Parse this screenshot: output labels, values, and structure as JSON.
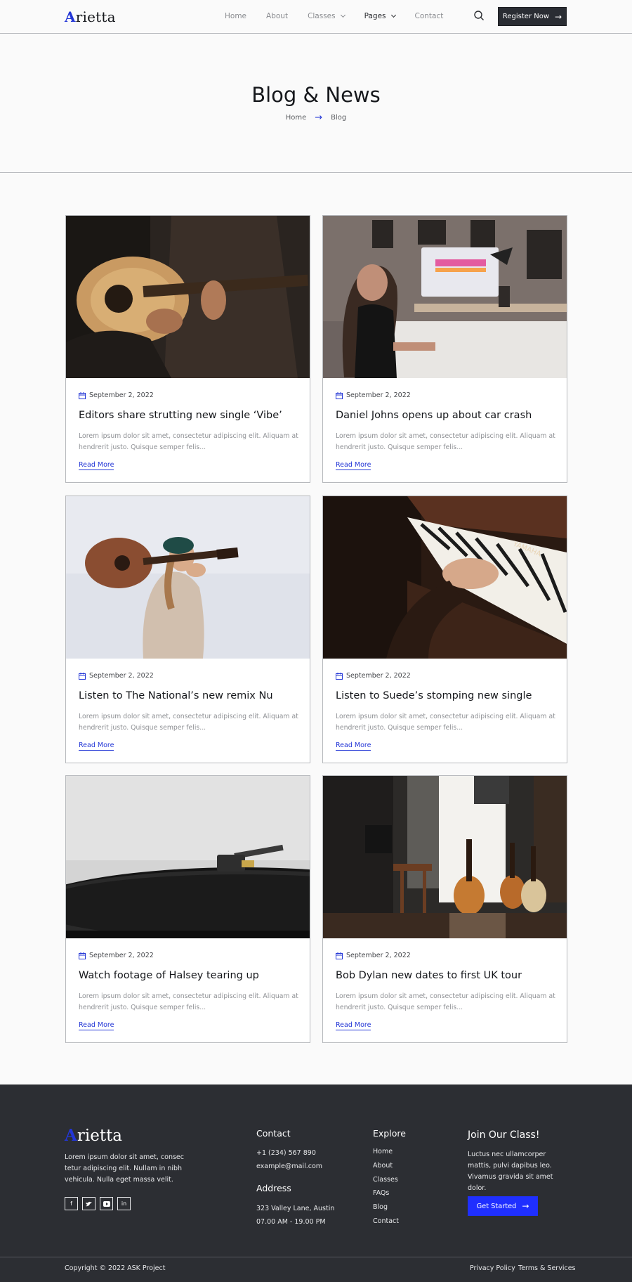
{
  "header": {
    "logo": "Arietta",
    "nav": [
      {
        "label": "Home"
      },
      {
        "label": "About"
      },
      {
        "label": "Classes"
      },
      {
        "label": "Pages"
      },
      {
        "label": "Contact"
      }
    ],
    "register_label": "Register Now"
  },
  "hero": {
    "title": "Blog & News",
    "breadcrumb": {
      "home": "Home",
      "current": "Blog"
    }
  },
  "posts": [
    {
      "date": "September 2, 2022",
      "title": "Editors share strutting new single ‘Vibe’",
      "excerpt": "Lorem ipsum dolor sit amet, consectetur adipiscing elit. Aliquam at hendrerit justo. Quisque semper felis...",
      "read_more": "Read More"
    },
    {
      "date": "September 2, 2022",
      "title": "Daniel Johns opens up about car crash",
      "excerpt": "Lorem ipsum dolor sit amet, consectetur adipiscing elit. Aliquam at hendrerit justo. Quisque semper felis...",
      "read_more": "Read More"
    },
    {
      "date": "September 2, 2022",
      "title": "Listen to The  National’s new remix  Nu",
      "excerpt": "Lorem ipsum dolor sit amet, consectetur adipiscing elit. Aliquam at hendrerit justo. Quisque semper felis...",
      "read_more": "Read More"
    },
    {
      "date": "September 2, 2022",
      "title": "Listen to Suede’s stomping new single",
      "excerpt": "Lorem ipsum dolor sit amet, consectetur adipiscing elit. Aliquam at hendrerit justo. Quisque semper felis...",
      "read_more": "Read More"
    },
    {
      "date": "September 2, 2022",
      "title": "Watch footage of  Halsey tearing up",
      "excerpt": "Lorem ipsum dolor sit amet, consectetur adipiscing elit. Aliquam at hendrerit justo. Quisque semper felis...",
      "read_more": "Read More"
    },
    {
      "date": "September 2, 2022",
      "title": "Bob  Dylan new dates to first UK tour",
      "excerpt": "Lorem ipsum dolor sit amet, consectetur adipiscing elit. Aliquam at hendrerit justo. Quisque semper felis...",
      "read_more": "Read More"
    }
  ],
  "footer": {
    "logo": "Arietta",
    "about": "Lorem ipsum dolor sit amet, consec tetur adipiscing elit.  Nullam in nibh vehicula. Nulla eget massa velit.",
    "socials": [
      "f",
      "t",
      "yt",
      "in"
    ],
    "contact_heading": "Contact",
    "phone": "+1 (234) 567 890",
    "email": "example@mail.com",
    "address_heading": "Address",
    "address": "323 Valley  Lane, Austin",
    "hours": "07.00 AM - 19.00  PM",
    "explore_heading": "Explore",
    "explore_links": [
      "Home",
      "About",
      "Classes",
      "FAQs",
      "Blog",
      "Contact"
    ],
    "join_heading": "Join Our Class!",
    "join_text": "Luctus nec ullamcorper mattis, pulvi dapibus leo. Vivamus gravida sit amet dolor.",
    "cta_label": "Get Started",
    "copyright": "Copyright © 2022 ASK  Project",
    "privacy": "Privacy  Policy",
    "terms": "Terms & Services"
  },
  "colors": {
    "accent": "#2336d6",
    "cta": "#1f2fff",
    "dark": "#2c2e33",
    "background": "#fafafa"
  }
}
